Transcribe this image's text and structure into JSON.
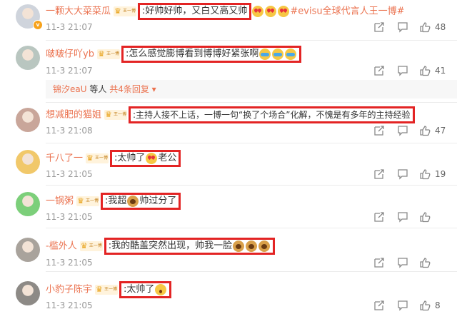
{
  "comments": [
    {
      "username": "一颗大大菜菜瓜",
      "badge": "王一博",
      "text_parts": [
        ":好帅好帅，又白又高又帅"
      ],
      "emojis": [
        "heart-eyes-emoji",
        "heart-eyes-emoji",
        "heart-eyes-emoji"
      ],
      "tag": "#evisu全球代言人王一博#",
      "time": "11-3 21:07",
      "likes": "48",
      "avatar_color": "#cfd4dc"
    },
    {
      "username": "啵啵仔吖yb",
      "badge": "王一博",
      "text_parts": [
        ":怎么感觉膨博看到博博好紧张啊"
      ],
      "emojis": [
        "crying-emoji",
        "crying-emoji",
        "crying-emoji"
      ],
      "time": "11-3 21:07",
      "likes": "41",
      "avatar_color": "#b9c6c0"
    },
    {
      "username": "想减肥的猫姐",
      "badge": "王一博",
      "text_parts": [
        ":主持人接不上话，一博一句“换了个场合”化解，不愧是有多年的主持经验"
      ],
      "time": "11-3 21:08",
      "likes": "47",
      "avatar_color": "#c9a69a"
    },
    {
      "username": "千八了一",
      "badge": "王一博",
      "text_parts": [
        ":太帅了",
        "老公"
      ],
      "emojis": [
        "heart-eyes-emoji"
      ],
      "time": "11-3 21:05",
      "likes": "19",
      "avatar_color": "#f1c86a"
    },
    {
      "username": "一锅粥",
      "badge": "王一博",
      "text_parts": [
        ":我超",
        "帅过分了"
      ],
      "emojis": [
        "doge-emoji"
      ],
      "time": "11-3 21:05",
      "likes": "",
      "avatar_color": "#7ccf7a"
    },
    {
      "username": "-槛外人",
      "badge": "王一博",
      "text_parts": [
        ":我的酷盖突然出现，帅我一脸"
      ],
      "emojis": [
        "doge-emoji",
        "doge-emoji",
        "doge-emoji"
      ],
      "time": "11-3 21:05",
      "likes": "",
      "avatar_color": "#a9a39c"
    },
    {
      "username": "小豹子陈宇",
      "badge": "王一博",
      "text_parts": [
        ":太帅了"
      ],
      "emojis": [
        "shocked-emoji"
      ],
      "time": "11-3 21:05",
      "likes": "8",
      "avatar_color": "#8d8a86"
    }
  ],
  "reply_summary": {
    "name": "锦汐eaU",
    "middle": "等人",
    "link": "共4条回复"
  }
}
